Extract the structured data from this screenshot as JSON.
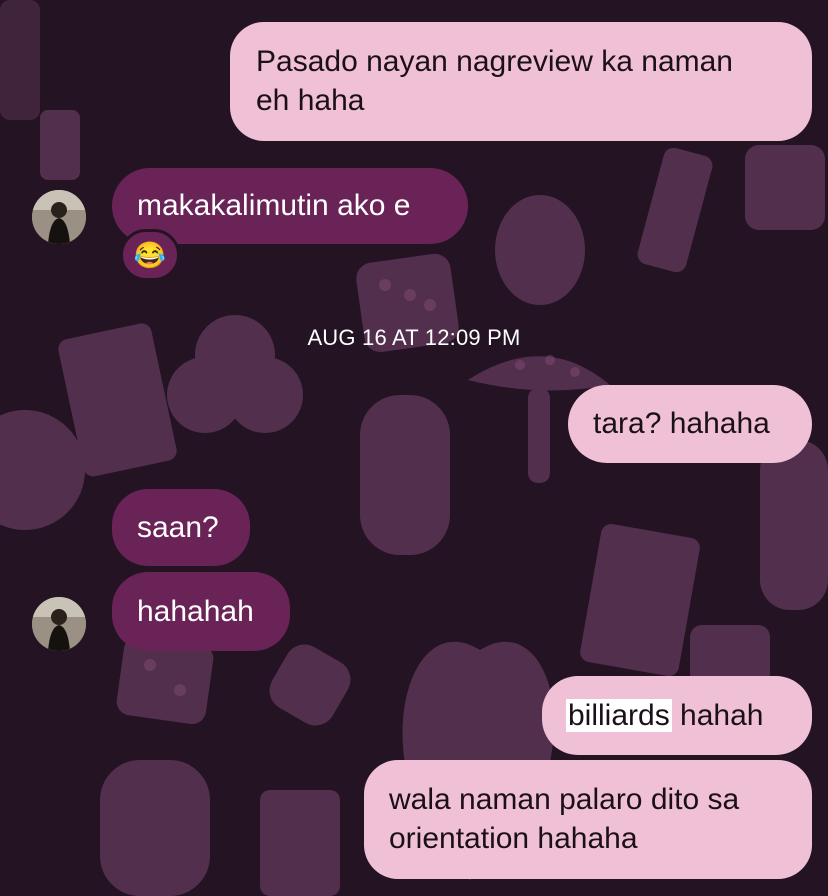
{
  "messages": [
    {
      "id": "m1",
      "dir": "out",
      "lines": [
        "Pasado nayan nagreview ka naman",
        "eh haha"
      ]
    },
    {
      "id": "m2",
      "dir": "in",
      "text": "makakalimutin ako e"
    },
    {
      "id": "m3",
      "dir": "out",
      "text": "tara? hahaha"
    },
    {
      "id": "m4",
      "dir": "in",
      "text": "saan?"
    },
    {
      "id": "m5",
      "dir": "in",
      "text": "hahahah"
    },
    {
      "id": "m6",
      "dir": "out",
      "highlight": "billiards",
      "rest": " hahah"
    },
    {
      "id": "m7",
      "dir": "out",
      "lines": [
        "wala naman palaro dito sa",
        "orientation hahaha"
      ]
    }
  ],
  "reaction": {
    "emoji": "😂",
    "icon": "laughing-tears-emoji"
  },
  "timestamp": "AUG 16 AT 12:09 PM",
  "colors": {
    "outgoing": "#f0c1d6",
    "incoming": "#6a2357",
    "background": "#241423"
  }
}
